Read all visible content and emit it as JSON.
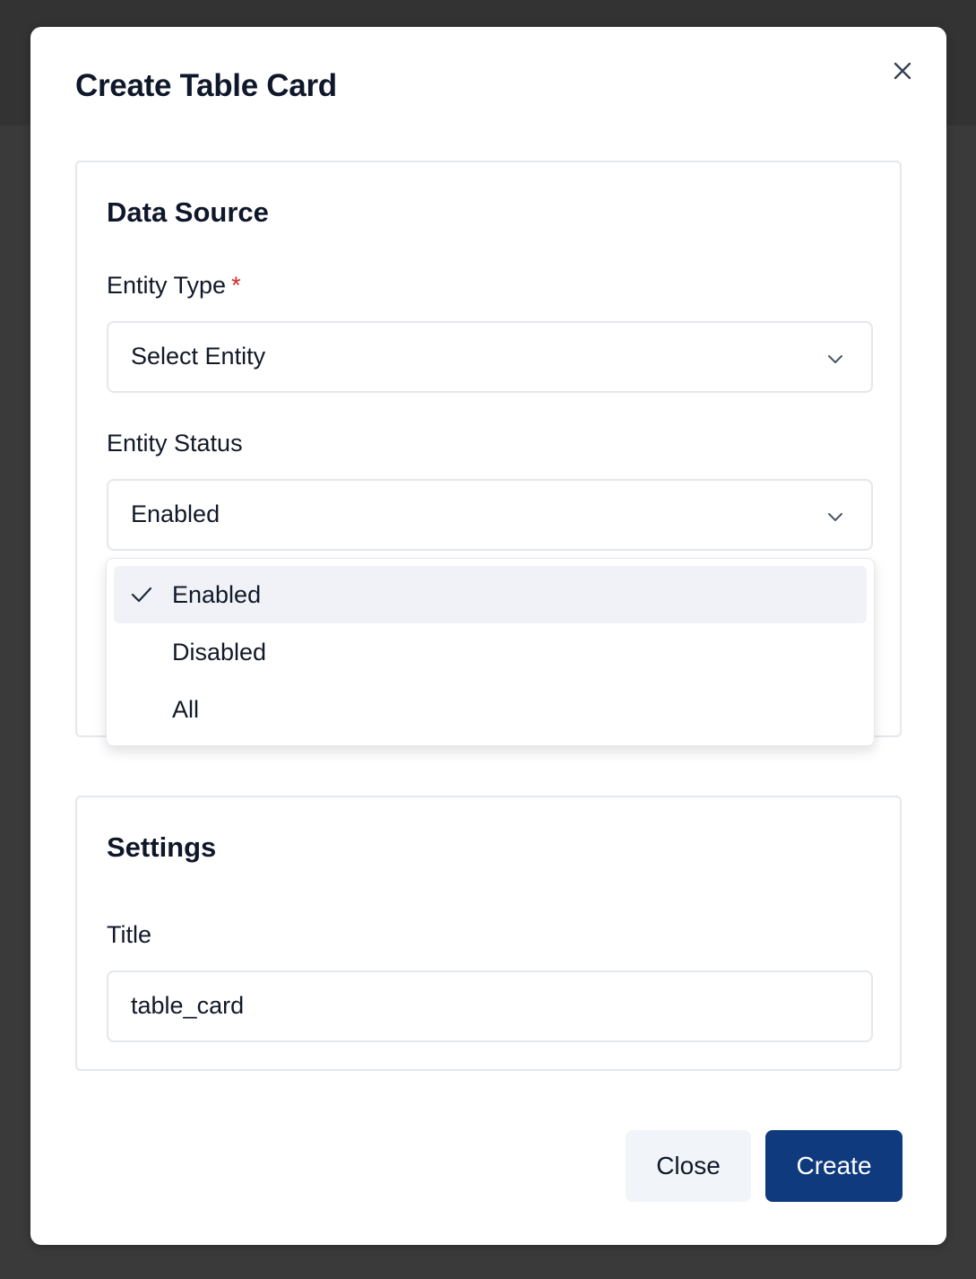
{
  "modal": {
    "title": "Create Table Card"
  },
  "data_source": {
    "title": "Data Source",
    "entity_type": {
      "label": "Entity Type",
      "required_marker": "*",
      "value": "Select Entity"
    },
    "entity_status": {
      "label": "Entity Status",
      "value": "Enabled",
      "options": [
        {
          "label": "Enabled",
          "selected": true
        },
        {
          "label": "Disabled",
          "selected": false
        },
        {
          "label": "All",
          "selected": false
        }
      ]
    }
  },
  "settings": {
    "title": "Settings",
    "title_field": {
      "label": "Title",
      "value": "table_card"
    }
  },
  "footer": {
    "close_label": "Close",
    "create_label": "Create"
  },
  "colors": {
    "primary": "#0f3a7d",
    "required": "#dc2626",
    "selected_bg": "#f0f2f7"
  },
  "icons": {
    "close": "close-icon",
    "chevron": "chevron-down-icon",
    "check": "check-icon"
  }
}
